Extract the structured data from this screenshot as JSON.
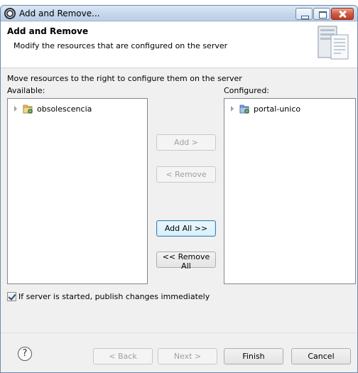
{
  "window": {
    "title": "Add and Remove..."
  },
  "banner": {
    "title": "Add and Remove",
    "description": "Modify the resources that are configured on the server"
  },
  "labels": {
    "instruction": "Move resources to the right to configure them on the server",
    "available": "Available:",
    "configured": "Configured:"
  },
  "available": {
    "items": [
      {
        "label": "obsolescencia",
        "icon": "project-icon"
      }
    ]
  },
  "configured": {
    "items": [
      {
        "label": "portal-unico",
        "icon": "project-icon"
      }
    ]
  },
  "buttons": {
    "add": "Add >",
    "remove": "< Remove",
    "add_all": "Add All >>",
    "remove_all": "<< Remove All"
  },
  "options": {
    "publish_immediately_label": "If server is started, publish changes immediately",
    "publish_immediately_checked": true
  },
  "footer": {
    "help": "?",
    "back": "< Back",
    "next": "Next >",
    "finish": "Finish",
    "cancel": "Cancel"
  },
  "colors": {
    "accent": "#3c7fb1",
    "titlebar": "#c3d6ec",
    "close": "#c13b23"
  }
}
